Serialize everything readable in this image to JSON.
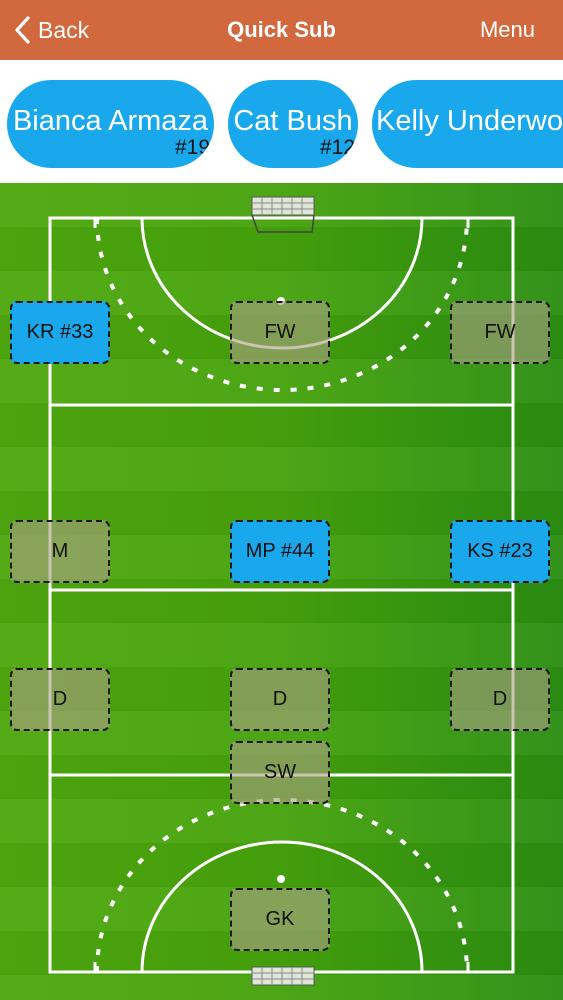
{
  "nav": {
    "back_label": "Back",
    "title": "Quick Sub",
    "menu_label": "Menu"
  },
  "bench": [
    {
      "name": "Bianca Armaza",
      "number": "#19"
    },
    {
      "name": "Cat Bush",
      "number": "#12"
    },
    {
      "name": "Kelly Underwo",
      "number": ""
    }
  ],
  "positions": {
    "fw_left": "KR #33",
    "fw_center": "FW",
    "fw_right": "FW",
    "m_left": "M",
    "m_center": "MP #44",
    "m_right": "KS #23",
    "d_left": "D",
    "d_center": "D",
    "d_right": "D",
    "sw": "SW",
    "gk": "GK"
  },
  "colors": {
    "nav": "#d2693e",
    "chip": "#1aa8ec",
    "field": "#46a20c",
    "empty_slot": "#aaa082"
  }
}
